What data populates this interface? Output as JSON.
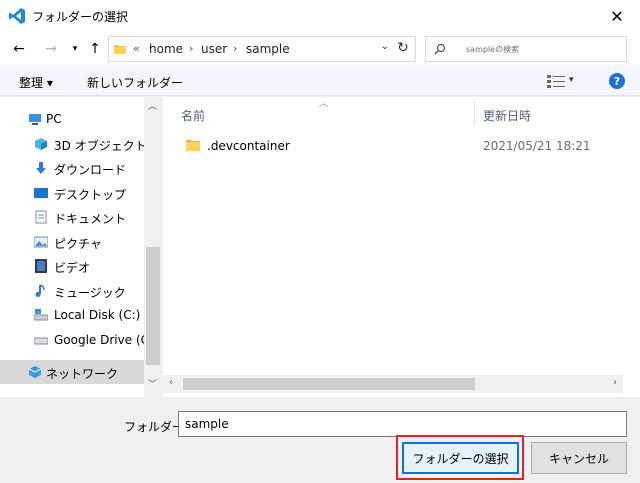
{
  "window": {
    "title": "フォルダーの選択"
  },
  "addressbar": {
    "overflow": "«",
    "crumbs": [
      "home",
      "user",
      "sample"
    ],
    "search_placeholder": "sampleの検索"
  },
  "toolbar": {
    "organize": "整理 ▾",
    "new_folder": "新しいフォルダー",
    "help": "?"
  },
  "nav": {
    "items": [
      {
        "label": "PC",
        "icon": "pc-icon"
      },
      {
        "label": "3D オブジェクト",
        "icon": "3d-objects-icon"
      },
      {
        "label": "ダウンロード",
        "icon": "download-icon"
      },
      {
        "label": "デスクトップ",
        "icon": "desktop-icon"
      },
      {
        "label": "ドキュメント",
        "icon": "document-icon"
      },
      {
        "label": "ピクチャ",
        "icon": "pictures-icon"
      },
      {
        "label": "ビデオ",
        "icon": "video-icon"
      },
      {
        "label": "ミュージック",
        "icon": "music-icon"
      },
      {
        "label": "Local Disk (C:)",
        "icon": "drive-icon"
      },
      {
        "label": "Google Drive (G:",
        "icon": "drive-icon"
      },
      {
        "label": "ネットワーク",
        "icon": "network-icon"
      }
    ]
  },
  "filelist": {
    "columns": {
      "name": "名前",
      "date": "更新日時"
    },
    "rows": [
      {
        "name": ".devcontainer",
        "date": "2021/05/21 18:21"
      }
    ]
  },
  "footer": {
    "folder_label": "フォルダー:",
    "folder_value": "sample",
    "select_button": "フォルダーの選択",
    "cancel_button": "キャンセル"
  },
  "colors": {
    "accent": "#0078d7",
    "highlight": "#e0202a",
    "help": "#1e6fd6"
  }
}
